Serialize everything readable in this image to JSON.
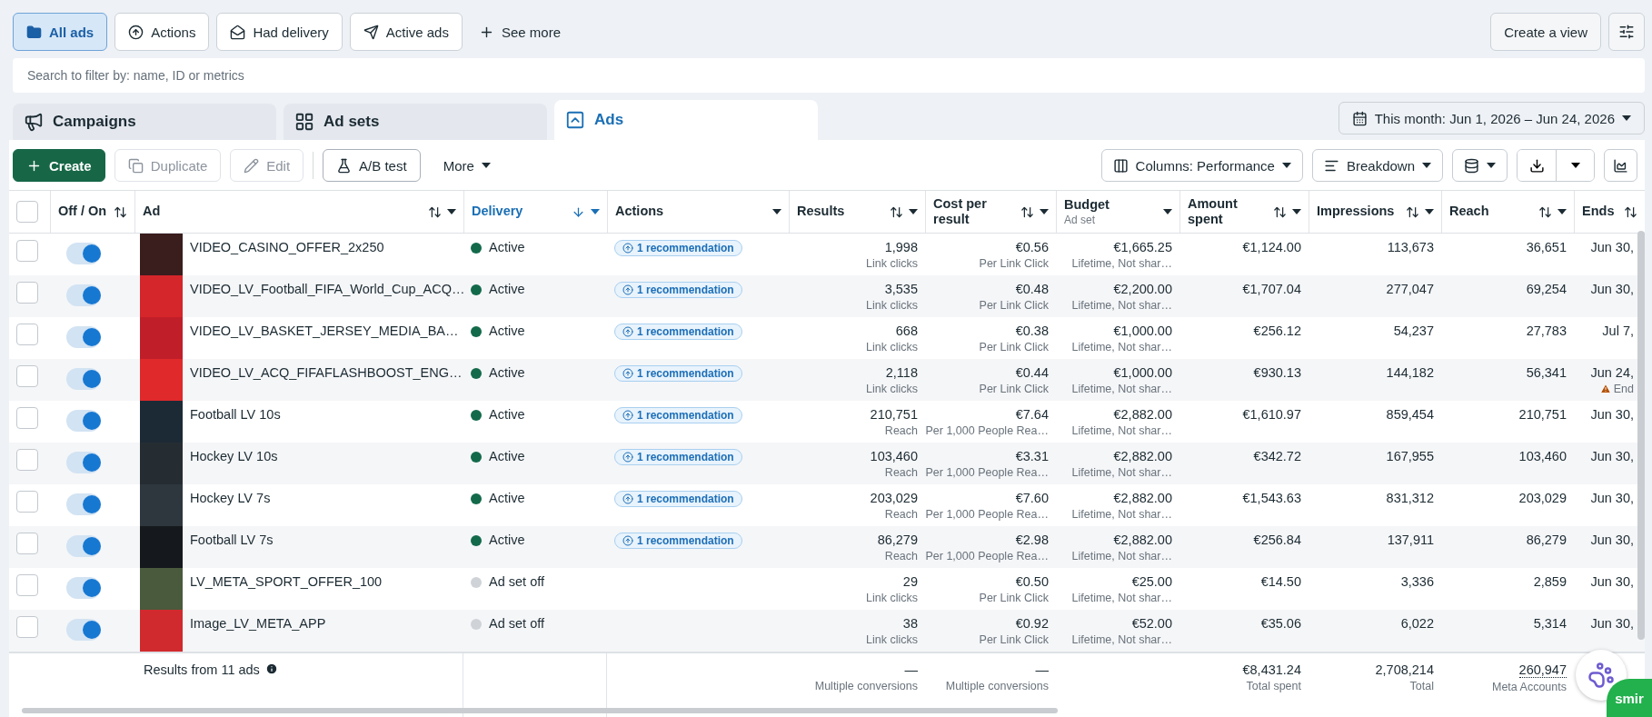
{
  "filters": [
    {
      "label": "All ads",
      "selected": true
    },
    {
      "label": "Actions",
      "selected": false
    },
    {
      "label": "Had delivery",
      "selected": false
    },
    {
      "label": "Active ads",
      "selected": false
    }
  ],
  "see_more": "See more",
  "create_view": "Create a view",
  "search": {
    "placeholder": "Search to filter by: name, ID or metrics"
  },
  "tabs": [
    {
      "label": "Campaigns",
      "selected": false
    },
    {
      "label": "Ad sets",
      "selected": false
    },
    {
      "label": "Ads",
      "selected": true
    }
  ],
  "date_range": "This month: Jun 1, 2026 – Jun 24, 2026",
  "toolbar": [
    {
      "label": "Create",
      "kind": "primary",
      "disabled": false
    },
    {
      "label": "Duplicate",
      "kind": "normal",
      "disabled": true
    },
    {
      "label": "Edit",
      "kind": "normal",
      "disabled": true
    },
    {
      "label": "A/B test",
      "kind": "outlined",
      "disabled": false
    },
    {
      "label": "More",
      "kind": "menu",
      "disabled": false
    }
  ],
  "columns_button": "Columns: Performance",
  "breakdown_button": "Breakdown",
  "table": {
    "select_all": {
      "checked": false
    },
    "columns": [
      {
        "label": "Off / On",
        "sortable": true,
        "menu": false,
        "sorted": false
      },
      {
        "label": "Ad",
        "sortable": true,
        "menu": true,
        "sorted": false
      },
      {
        "label": "Delivery",
        "sortable": true,
        "menu": true,
        "sorted": true
      },
      {
        "label": "Actions",
        "sortable": false,
        "menu": true,
        "sorted": false
      },
      {
        "label": "Results",
        "sortable": true,
        "menu": true,
        "sorted": false
      },
      {
        "label": "Cost per result",
        "sortable": true,
        "menu": true,
        "sorted": false
      },
      {
        "label": "Budget",
        "sub": "Ad set",
        "sortable": false,
        "menu": true,
        "sorted": false
      },
      {
        "label": "Amount spent",
        "sortable": true,
        "menu": true,
        "sorted": false
      },
      {
        "label": "Impressions",
        "sortable": true,
        "menu": true,
        "sorted": false
      },
      {
        "label": "Reach",
        "sortable": true,
        "menu": true,
        "sorted": false
      },
      {
        "label": "Ends",
        "sortable": true,
        "menu": false,
        "sorted": false
      }
    ],
    "rows": [
      {
        "checked": false,
        "on": true,
        "name": "VIDEO_CASINO_OFFER_2x250",
        "thumbnail": {
          "color": "#3a1d1d"
        },
        "delivery": {
          "label": "Active",
          "color": "#136a4b"
        },
        "recommendation": "1 recommendation",
        "results": "1,998",
        "results_sub": "Link clicks",
        "cost": "€0.56",
        "cost_sub": "Per Link Click",
        "budget": "€1,665.25",
        "budget_sub": "Lifetime, Not shar…",
        "amount": "€1,124.00",
        "impressions": "113,673",
        "reach": "36,651",
        "ends": "Jun 30,"
      },
      {
        "checked": false,
        "on": true,
        "name": "VIDEO_LV_Football_FIFA_World_Cup_ACQ…",
        "thumbnail": {
          "color": "#d5262b"
        },
        "delivery": {
          "label": "Active",
          "color": "#136a4b"
        },
        "recommendation": "1 recommendation",
        "results": "3,535",
        "results_sub": "Link clicks",
        "cost": "€0.48",
        "cost_sub": "Per Link Click",
        "budget": "€2,200.00",
        "budget_sub": "Lifetime, Not shar…",
        "amount": "€1,707.04",
        "impressions": "277,047",
        "reach": "69,254",
        "ends": "Jun 30,"
      },
      {
        "checked": false,
        "on": true,
        "name": "VIDEO_LV_BASKET_JERSEY_MEDIA_BA…",
        "thumbnail": {
          "color": "#c01f2a"
        },
        "delivery": {
          "label": "Active",
          "color": "#136a4b"
        },
        "recommendation": "1 recommendation",
        "results": "668",
        "results_sub": "Link clicks",
        "cost": "€0.38",
        "cost_sub": "Per Link Click",
        "budget": "€1,000.00",
        "budget_sub": "Lifetime, Not shar…",
        "amount": "€256.12",
        "impressions": "54,237",
        "reach": "27,783",
        "ends": "Jul 7,"
      },
      {
        "checked": false,
        "on": true,
        "name": "VIDEO_LV_ACQ_FIFAFLASHBOOST_ENG…",
        "thumbnail": {
          "color": "#e0292b"
        },
        "delivery": {
          "label": "Active",
          "color": "#136a4b"
        },
        "recommendation": "1 recommendation",
        "results": "2,118",
        "results_sub": "Link clicks",
        "cost": "€0.44",
        "cost_sub": "Per Link Click",
        "budget": "€1,000.00",
        "budget_sub": "Lifetime, Not shar…",
        "amount": "€930.13",
        "impressions": "144,182",
        "reach": "56,341",
        "ends": "Jun 24,",
        "ends_note": "End"
      },
      {
        "checked": false,
        "on": true,
        "name": "Football LV 10s",
        "thumbnail": {
          "color": "#1c2a36"
        },
        "delivery": {
          "label": "Active",
          "color": "#136a4b"
        },
        "recommendation": "1 recommendation",
        "results": "210,751",
        "results_sub": "Reach",
        "cost": "€7.64",
        "cost_sub": "Per 1,000 People Rea…",
        "budget": "€2,882.00",
        "budget_sub": "Lifetime, Not shar…",
        "amount": "€1,610.97",
        "impressions": "859,454",
        "reach": "210,751",
        "ends": "Jun 30,"
      },
      {
        "checked": false,
        "on": true,
        "name": "Hockey LV 10s",
        "thumbnail": {
          "color": "#252d33"
        },
        "delivery": {
          "label": "Active",
          "color": "#136a4b"
        },
        "recommendation": "1 recommendation",
        "results": "103,460",
        "results_sub": "Reach",
        "cost": "€3.31",
        "cost_sub": "Per 1,000 People Rea…",
        "budget": "€2,882.00",
        "budget_sub": "Lifetime, Not shar…",
        "amount": "€342.72",
        "impressions": "167,955",
        "reach": "103,460",
        "ends": "Jun 30,"
      },
      {
        "checked": false,
        "on": true,
        "name": "Hockey LV 7s",
        "thumbnail": {
          "color": "#2e373d"
        },
        "delivery": {
          "label": "Active",
          "color": "#136a4b"
        },
        "recommendation": "1 recommendation",
        "results": "203,029",
        "results_sub": "Reach",
        "cost": "€7.60",
        "cost_sub": "Per 1,000 People Rea…",
        "budget": "€2,882.00",
        "budget_sub": "Lifetime, Not shar…",
        "amount": "€1,543.63",
        "impressions": "831,312",
        "reach": "203,029",
        "ends": "Jun 30,"
      },
      {
        "checked": false,
        "on": true,
        "name": "Football LV 7s",
        "thumbnail": {
          "color": "#15191d"
        },
        "delivery": {
          "label": "Active",
          "color": "#136a4b"
        },
        "recommendation": "1 recommendation",
        "results": "86,279",
        "results_sub": "Reach",
        "cost": "€2.98",
        "cost_sub": "Per 1,000 People Rea…",
        "budget": "€2,882.00",
        "budget_sub": "Lifetime, Not shar…",
        "amount": "€256.84",
        "impressions": "137,911",
        "reach": "86,279",
        "ends": "Jun 30,"
      },
      {
        "checked": false,
        "on": true,
        "name": "LV_META_SPORT_OFFER_100",
        "thumbnail": {
          "color": "#4a5a3c"
        },
        "delivery": {
          "label": "Ad set off",
          "color": "#cfd3d8"
        },
        "results": "29",
        "results_sub": "Link clicks",
        "cost": "€0.50",
        "cost_sub": "Per Link Click",
        "budget": "€25.00",
        "budget_sub": "Lifetime, Not shar…",
        "amount": "€14.50",
        "impressions": "3,336",
        "reach": "2,859",
        "ends": "Jun 30,"
      },
      {
        "checked": false,
        "on": true,
        "name": "Image_LV_META_APP",
        "thumbnail": {
          "color": "#d12a2e"
        },
        "delivery": {
          "label": "Ad set off",
          "color": "#cfd3d8"
        },
        "results": "38",
        "results_sub": "Link clicks",
        "cost": "€0.92",
        "cost_sub": "Per Link Click",
        "budget": "€52.00",
        "budget_sub": "Lifetime, Not shar…",
        "amount": "€35.06",
        "impressions": "6,022",
        "reach": "5,314",
        "ends": "Jun 30,"
      }
    ],
    "footer": {
      "label": "Results from 11 ads",
      "results": "—",
      "results_sub": "Multiple conversions",
      "cost": "—",
      "cost_sub": "Multiple conversions",
      "amount": "€8,431.24",
      "amount_sub": "Total spent",
      "impressions": "2,708,214",
      "impressions_sub": "Total",
      "reach": "260,947",
      "reach_sub": "Meta Accounts"
    }
  },
  "chat_widget": {
    "label": "smir"
  }
}
